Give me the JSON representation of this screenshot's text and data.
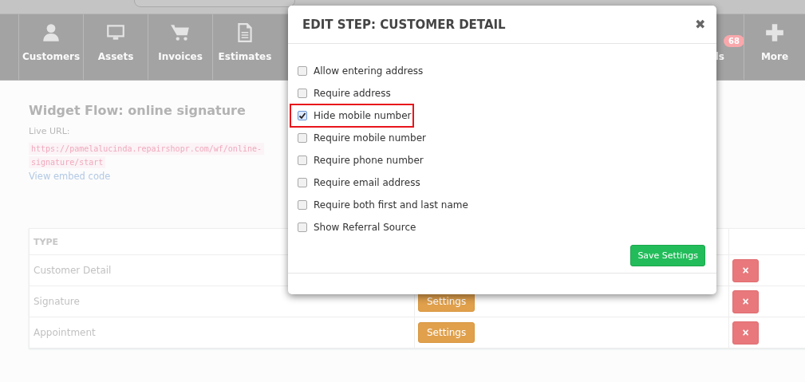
{
  "nav": {
    "items": [
      {
        "label": "Customers"
      },
      {
        "label": "Assets"
      },
      {
        "label": "Invoices"
      },
      {
        "label": "Estimates"
      }
    ],
    "right_items": [
      {
        "label": "ls",
        "badge": "68"
      },
      {
        "label": "More"
      }
    ]
  },
  "page": {
    "title": "Widget Flow: online signature",
    "live_url_label": "Live URL:",
    "url_lines": [
      "https://pamelalucinda.repairshopr.com/wf/online-",
      "signature/start"
    ],
    "embed_link": "View embed code"
  },
  "table": {
    "columns": [
      "TYPE"
    ],
    "rows": [
      {
        "type": "Customer Detail",
        "settings": null,
        "delete": "×"
      },
      {
        "type": "Signature",
        "settings": "Settings",
        "delete": "×"
      },
      {
        "type": "Appointment",
        "settings": "Settings",
        "delete": "×"
      }
    ]
  },
  "modal": {
    "title": "EDIT STEP: CUSTOMER DETAIL",
    "close": "✖",
    "options": [
      {
        "label": "Allow entering address",
        "checked": false,
        "highlighted": false
      },
      {
        "label": "Require address",
        "checked": false,
        "highlighted": false
      },
      {
        "label": "Hide mobile number",
        "checked": true,
        "highlighted": true
      },
      {
        "label": "Require mobile number",
        "checked": false,
        "highlighted": false
      },
      {
        "label": "Require phone number",
        "checked": false,
        "highlighted": false
      },
      {
        "label": "Require email address",
        "checked": false,
        "highlighted": false
      },
      {
        "label": "Require both first and last name",
        "checked": false,
        "highlighted": false
      },
      {
        "label": "Show Referral Source",
        "checked": false,
        "highlighted": false
      }
    ],
    "save_button": "Save Settings"
  }
}
